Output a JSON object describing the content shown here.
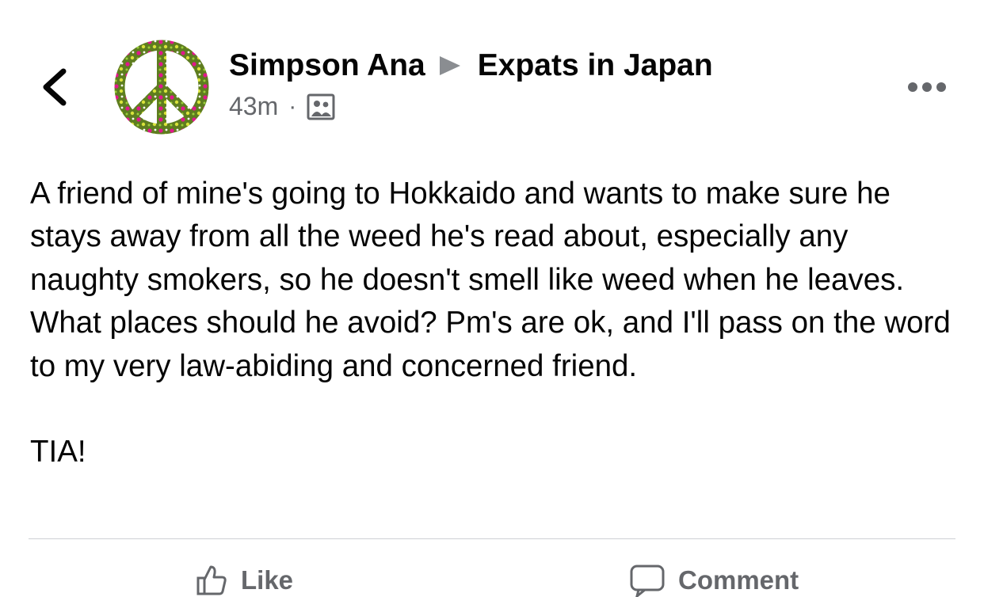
{
  "header": {
    "author_name": "Simpson Ana",
    "group_name": "Expats in Japan",
    "timestamp": "43m",
    "separator": "·",
    "privacy_icon": "group-members-icon",
    "back_icon": "chevron-left-icon",
    "more_icon": "more-horizontal-icon",
    "avatar_icon": "peace-sign-avatar"
  },
  "post": {
    "paragraphs": [
      "A friend of mine's going to Hokkaido and wants to make sure he stays away from all the weed he's read about, especially any naughty smokers, so he doesn't smell like weed when he leaves. What places should he avoid? Pm's are ok, and I'll pass on the word to my very law-abiding and concerned friend.",
      "TIA!"
    ]
  },
  "actions": {
    "like_label": "Like",
    "comment_label": "Comment"
  },
  "colors": {
    "text": "#050505",
    "secondary_text": "#65676b",
    "divider": "#ced0d4",
    "avatar_green": "#5e7d1f",
    "avatar_pink": "#e0188c"
  }
}
